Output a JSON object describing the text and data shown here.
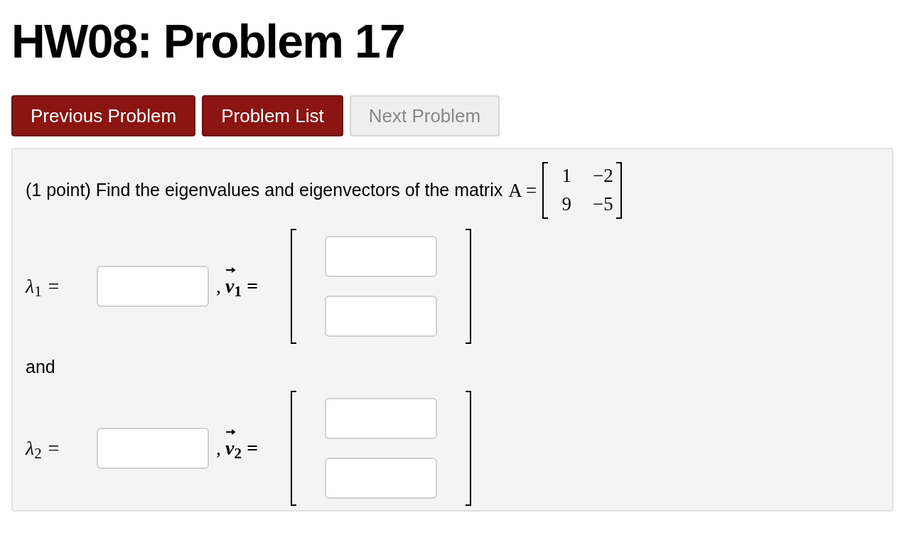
{
  "title": "HW08: Problem 17",
  "nav_buttons": [
    {
      "label": "Previous Problem",
      "disabled": false
    },
    {
      "label": "Problem List",
      "disabled": false
    },
    {
      "label": "Next Problem",
      "disabled": true
    }
  ],
  "problem": {
    "prompt": "(1 point) Find the eigenvalues and eigenvectors of the matrix",
    "matrix_label": "A =",
    "matrix": [
      [
        "1",
        "−2"
      ],
      [
        "9",
        "−5"
      ]
    ],
    "answers": [
      {
        "eigenvalue_label": "λ$_{1}$ =",
        "comma": ",",
        "vector_label": "v$_{1}$ ="
      },
      {
        "eigenvalue_label": "λ$_{2}$ =",
        "comma": ",",
        "vector_label": "v$_{2}$ ="
      }
    ],
    "separator": "and"
  }
}
